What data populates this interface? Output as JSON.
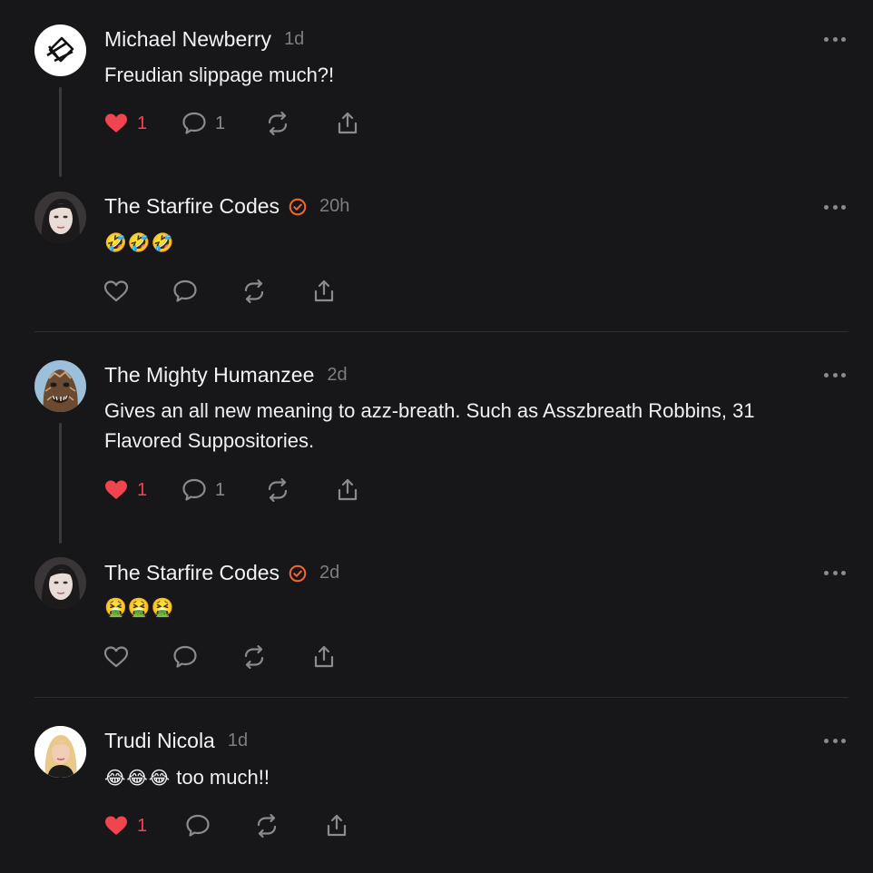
{
  "posts": [
    {
      "author": "Michael Newberry",
      "time": "1d",
      "verified": false,
      "text": "Freudian slippage much?!",
      "liked": true,
      "likes": "1",
      "replies": "1",
      "avatar_icon": "abstract-logo-avatar"
    },
    {
      "author": "The Starfire Codes",
      "time": "20h",
      "verified": true,
      "emoji": "🤣🤣🤣",
      "liked": false,
      "avatar_icon": "woman-portrait-avatar"
    },
    {
      "author": "The Mighty Humanzee",
      "time": "2d",
      "verified": false,
      "text_lines": [
        "Gives an all new meaning to azz-breath. Such as Asszbreath Robbins, 31",
        "Flavored Suppositories."
      ],
      "liked": true,
      "likes": "1",
      "replies": "1",
      "avatar_icon": "creature-portrait-avatar"
    },
    {
      "author": "The Starfire Codes",
      "time": "2d",
      "verified": true,
      "emoji": "🤮🤮🤮",
      "liked": false,
      "avatar_icon": "woman-portrait-avatar"
    },
    {
      "author": "Trudi Nicola",
      "time": "1d",
      "verified": false,
      "emoji": "😂😂😂",
      "text": "too much!!",
      "liked": true,
      "likes": "1",
      "avatar_icon": "blonde-woman-avatar"
    }
  ],
  "colors": {
    "background": "#17171a",
    "like_red": "#f0444e",
    "verified_orange": "#f2682a",
    "muted": "#8a8a8f"
  }
}
